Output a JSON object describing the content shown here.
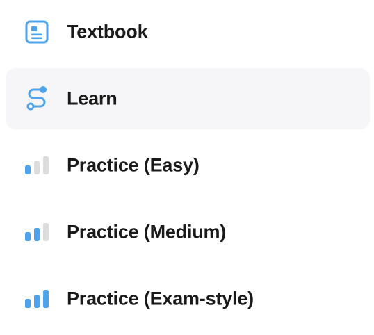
{
  "menu": {
    "items": [
      {
        "label": "Textbook",
        "icon": "textbook-icon",
        "active": false
      },
      {
        "label": "Learn",
        "icon": "learn-path-icon",
        "active": true
      },
      {
        "label": "Practice (Easy)",
        "icon": "difficulty-easy-icon",
        "level": 1,
        "active": false
      },
      {
        "label": "Practice (Medium)",
        "icon": "difficulty-medium-icon",
        "level": 2,
        "active": false
      },
      {
        "label": "Practice (Exam-style)",
        "icon": "difficulty-exam-icon",
        "level": 3,
        "active": false
      }
    ]
  },
  "colors": {
    "accent": "#4fa3ea",
    "inactive_bar": "#dcdcdc",
    "text": "#1a1a1a",
    "active_background": "#f6f6f8"
  }
}
